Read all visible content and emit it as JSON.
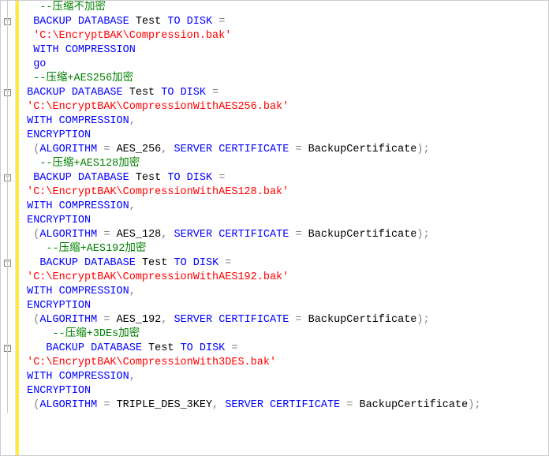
{
  "code": {
    "lines": [
      {
        "indent": 2,
        "fold": false,
        "tokens": [
          {
            "cls": "tok-comment",
            "t": "--压缩不加密"
          }
        ]
      },
      {
        "indent": 1,
        "fold": true,
        "tokens": [
          {
            "cls": "tok-keyword",
            "t": "BACKUP"
          },
          {
            "cls": "",
            "t": " "
          },
          {
            "cls": "tok-keyword",
            "t": "DATABASE"
          },
          {
            "cls": "",
            "t": " "
          },
          {
            "cls": "tok-ident",
            "t": "Test"
          },
          {
            "cls": "",
            "t": " "
          },
          {
            "cls": "tok-keyword",
            "t": "TO"
          },
          {
            "cls": "",
            "t": " "
          },
          {
            "cls": "tok-keyword",
            "t": "DISK"
          },
          {
            "cls": "",
            "t": " "
          },
          {
            "cls": "tok-gray",
            "t": "="
          }
        ]
      },
      {
        "indent": 1,
        "fold": false,
        "tokens": [
          {
            "cls": "tok-string",
            "t": "'C:\\EncryptBAK\\Compression.bak'"
          }
        ]
      },
      {
        "indent": 1,
        "fold": false,
        "tokens": [
          {
            "cls": "tok-keyword",
            "t": "WITH"
          },
          {
            "cls": "",
            "t": " "
          },
          {
            "cls": "tok-keyword",
            "t": "COMPRESSION"
          }
        ]
      },
      {
        "indent": 1,
        "fold": false,
        "tokens": [
          {
            "cls": "tok-keyword",
            "t": "go"
          }
        ]
      },
      {
        "indent": 1,
        "fold": false,
        "tokens": [
          {
            "cls": "tok-comment",
            "t": "--压缩+AES256加密"
          }
        ]
      },
      {
        "indent": 0,
        "fold": true,
        "tokens": [
          {
            "cls": "tok-keyword",
            "t": "BACKUP"
          },
          {
            "cls": "",
            "t": " "
          },
          {
            "cls": "tok-keyword",
            "t": "DATABASE"
          },
          {
            "cls": "",
            "t": " "
          },
          {
            "cls": "tok-ident",
            "t": "Test"
          },
          {
            "cls": "",
            "t": " "
          },
          {
            "cls": "tok-keyword",
            "t": "TO"
          },
          {
            "cls": "",
            "t": " "
          },
          {
            "cls": "tok-keyword",
            "t": "DISK"
          },
          {
            "cls": "",
            "t": " "
          },
          {
            "cls": "tok-gray",
            "t": "="
          }
        ]
      },
      {
        "indent": 0,
        "fold": false,
        "tokens": [
          {
            "cls": "tok-string",
            "t": "'C:\\EncryptBAK\\CompressionWithAES256.bak'"
          }
        ]
      },
      {
        "indent": 0,
        "fold": false,
        "tokens": [
          {
            "cls": "tok-keyword",
            "t": "WITH"
          },
          {
            "cls": "",
            "t": " "
          },
          {
            "cls": "tok-keyword",
            "t": "COMPRESSION"
          },
          {
            "cls": "tok-gray",
            "t": ","
          }
        ]
      },
      {
        "indent": 0,
        "fold": false,
        "tokens": [
          {
            "cls": "tok-keyword",
            "t": "ENCRYPTION"
          }
        ]
      },
      {
        "indent": 1,
        "fold": false,
        "tokens": [
          {
            "cls": "tok-gray",
            "t": "("
          },
          {
            "cls": "tok-keyword",
            "t": "ALGORITHM"
          },
          {
            "cls": "",
            "t": " "
          },
          {
            "cls": "tok-gray",
            "t": "="
          },
          {
            "cls": "",
            "t": " "
          },
          {
            "cls": "tok-ident",
            "t": "AES_256"
          },
          {
            "cls": "tok-gray",
            "t": ","
          },
          {
            "cls": "",
            "t": " "
          },
          {
            "cls": "tok-keyword",
            "t": "SERVER"
          },
          {
            "cls": "",
            "t": " "
          },
          {
            "cls": "tok-keyword",
            "t": "CERTIFICATE"
          },
          {
            "cls": "",
            "t": " "
          },
          {
            "cls": "tok-gray",
            "t": "="
          },
          {
            "cls": "",
            "t": " "
          },
          {
            "cls": "tok-ident",
            "t": "BackupCertificate"
          },
          {
            "cls": "tok-gray",
            "t": ");"
          }
        ]
      },
      {
        "indent": 2,
        "fold": false,
        "tokens": [
          {
            "cls": "tok-comment",
            "t": "--压缩+AES128加密"
          }
        ]
      },
      {
        "indent": 1,
        "fold": true,
        "tokens": [
          {
            "cls": "tok-keyword",
            "t": "BACKUP"
          },
          {
            "cls": "",
            "t": " "
          },
          {
            "cls": "tok-keyword",
            "t": "DATABASE"
          },
          {
            "cls": "",
            "t": " "
          },
          {
            "cls": "tok-ident",
            "t": "Test"
          },
          {
            "cls": "",
            "t": " "
          },
          {
            "cls": "tok-keyword",
            "t": "TO"
          },
          {
            "cls": "",
            "t": " "
          },
          {
            "cls": "tok-keyword",
            "t": "DISK"
          },
          {
            "cls": "",
            "t": " "
          },
          {
            "cls": "tok-gray",
            "t": "="
          }
        ]
      },
      {
        "indent": 0,
        "fold": false,
        "tokens": [
          {
            "cls": "tok-string",
            "t": "'C:\\EncryptBAK\\CompressionWithAES128.bak'"
          }
        ]
      },
      {
        "indent": 0,
        "fold": false,
        "tokens": [
          {
            "cls": "tok-keyword",
            "t": "WITH"
          },
          {
            "cls": "",
            "t": " "
          },
          {
            "cls": "tok-keyword",
            "t": "COMPRESSION"
          },
          {
            "cls": "tok-gray",
            "t": ","
          }
        ]
      },
      {
        "indent": 0,
        "fold": false,
        "tokens": [
          {
            "cls": "tok-keyword",
            "t": "ENCRYPTION"
          }
        ]
      },
      {
        "indent": 1,
        "fold": false,
        "tokens": [
          {
            "cls": "tok-gray",
            "t": "("
          },
          {
            "cls": "tok-keyword",
            "t": "ALGORITHM"
          },
          {
            "cls": "",
            "t": " "
          },
          {
            "cls": "tok-gray",
            "t": "="
          },
          {
            "cls": "",
            "t": " "
          },
          {
            "cls": "tok-ident",
            "t": "AES_128"
          },
          {
            "cls": "tok-gray",
            "t": ","
          },
          {
            "cls": "",
            "t": " "
          },
          {
            "cls": "tok-keyword",
            "t": "SERVER"
          },
          {
            "cls": "",
            "t": " "
          },
          {
            "cls": "tok-keyword",
            "t": "CERTIFICATE"
          },
          {
            "cls": "",
            "t": " "
          },
          {
            "cls": "tok-gray",
            "t": "="
          },
          {
            "cls": "",
            "t": " "
          },
          {
            "cls": "tok-ident",
            "t": "BackupCertificate"
          },
          {
            "cls": "tok-gray",
            "t": ");"
          }
        ]
      },
      {
        "indent": 3,
        "fold": false,
        "tokens": [
          {
            "cls": "tok-comment",
            "t": "--压缩+AES192加密"
          }
        ]
      },
      {
        "indent": 2,
        "fold": true,
        "tokens": [
          {
            "cls": "tok-keyword",
            "t": "BACKUP"
          },
          {
            "cls": "",
            "t": " "
          },
          {
            "cls": "tok-keyword",
            "t": "DATABASE"
          },
          {
            "cls": "",
            "t": " "
          },
          {
            "cls": "tok-ident",
            "t": "Test"
          },
          {
            "cls": "",
            "t": " "
          },
          {
            "cls": "tok-keyword",
            "t": "TO"
          },
          {
            "cls": "",
            "t": " "
          },
          {
            "cls": "tok-keyword",
            "t": "DISK"
          },
          {
            "cls": "",
            "t": " "
          },
          {
            "cls": "tok-gray",
            "t": "="
          }
        ]
      },
      {
        "indent": 0,
        "fold": false,
        "tokens": [
          {
            "cls": "tok-string",
            "t": "'C:\\EncryptBAK\\CompressionWithAES192.bak'"
          }
        ]
      },
      {
        "indent": 0,
        "fold": false,
        "tokens": [
          {
            "cls": "tok-keyword",
            "t": "WITH"
          },
          {
            "cls": "",
            "t": " "
          },
          {
            "cls": "tok-keyword",
            "t": "COMPRESSION"
          },
          {
            "cls": "tok-gray",
            "t": ","
          }
        ]
      },
      {
        "indent": 0,
        "fold": false,
        "tokens": [
          {
            "cls": "tok-keyword",
            "t": "ENCRYPTION"
          }
        ]
      },
      {
        "indent": 1,
        "fold": false,
        "tokens": [
          {
            "cls": "tok-gray",
            "t": "("
          },
          {
            "cls": "tok-keyword",
            "t": "ALGORITHM"
          },
          {
            "cls": "",
            "t": " "
          },
          {
            "cls": "tok-gray",
            "t": "="
          },
          {
            "cls": "",
            "t": " "
          },
          {
            "cls": "tok-ident",
            "t": "AES_192"
          },
          {
            "cls": "tok-gray",
            "t": ","
          },
          {
            "cls": "",
            "t": " "
          },
          {
            "cls": "tok-keyword",
            "t": "SERVER"
          },
          {
            "cls": "",
            "t": " "
          },
          {
            "cls": "tok-keyword",
            "t": "CERTIFICATE"
          },
          {
            "cls": "",
            "t": " "
          },
          {
            "cls": "tok-gray",
            "t": "="
          },
          {
            "cls": "",
            "t": " "
          },
          {
            "cls": "tok-ident",
            "t": "BackupCertificate"
          },
          {
            "cls": "tok-gray",
            "t": ");"
          }
        ]
      },
      {
        "indent": 4,
        "fold": false,
        "tokens": [
          {
            "cls": "tok-comment",
            "t": "--压缩+3DEs加密"
          }
        ]
      },
      {
        "indent": 3,
        "fold": true,
        "tokens": [
          {
            "cls": "tok-keyword",
            "t": "BACKUP"
          },
          {
            "cls": "",
            "t": " "
          },
          {
            "cls": "tok-keyword",
            "t": "DATABASE"
          },
          {
            "cls": "",
            "t": " "
          },
          {
            "cls": "tok-ident",
            "t": "Test"
          },
          {
            "cls": "",
            "t": " "
          },
          {
            "cls": "tok-keyword",
            "t": "TO"
          },
          {
            "cls": "",
            "t": " "
          },
          {
            "cls": "tok-keyword",
            "t": "DISK"
          },
          {
            "cls": "",
            "t": " "
          },
          {
            "cls": "tok-gray",
            "t": "="
          }
        ]
      },
      {
        "indent": 0,
        "fold": false,
        "tokens": [
          {
            "cls": "tok-string",
            "t": "'C:\\EncryptBAK\\CompressionWith3DES.bak'"
          }
        ]
      },
      {
        "indent": 0,
        "fold": false,
        "tokens": [
          {
            "cls": "tok-keyword",
            "t": "WITH"
          },
          {
            "cls": "",
            "t": " "
          },
          {
            "cls": "tok-keyword",
            "t": "COMPRESSION"
          },
          {
            "cls": "tok-gray",
            "t": ","
          }
        ]
      },
      {
        "indent": 0,
        "fold": false,
        "tokens": [
          {
            "cls": "tok-keyword",
            "t": "ENCRYPTION"
          }
        ]
      },
      {
        "indent": 1,
        "fold": false,
        "tokens": [
          {
            "cls": "tok-gray",
            "t": "("
          },
          {
            "cls": "tok-keyword",
            "t": "ALGORITHM"
          },
          {
            "cls": "",
            "t": " "
          },
          {
            "cls": "tok-gray",
            "t": "="
          },
          {
            "cls": "",
            "t": " "
          },
          {
            "cls": "tok-ident",
            "t": "TRIPLE_DES_3KEY"
          },
          {
            "cls": "tok-gray",
            "t": ","
          },
          {
            "cls": "",
            "t": " "
          },
          {
            "cls": "tok-keyword",
            "t": "SERVER"
          },
          {
            "cls": "",
            "t": " "
          },
          {
            "cls": "tok-keyword",
            "t": "CERTIFICATE"
          },
          {
            "cls": "",
            "t": " "
          },
          {
            "cls": "tok-gray",
            "t": "="
          },
          {
            "cls": "",
            "t": " "
          },
          {
            "cls": "tok-ident",
            "t": "BackupCertificate"
          },
          {
            "cls": "tok-gray",
            "t": ");"
          }
        ]
      }
    ]
  }
}
